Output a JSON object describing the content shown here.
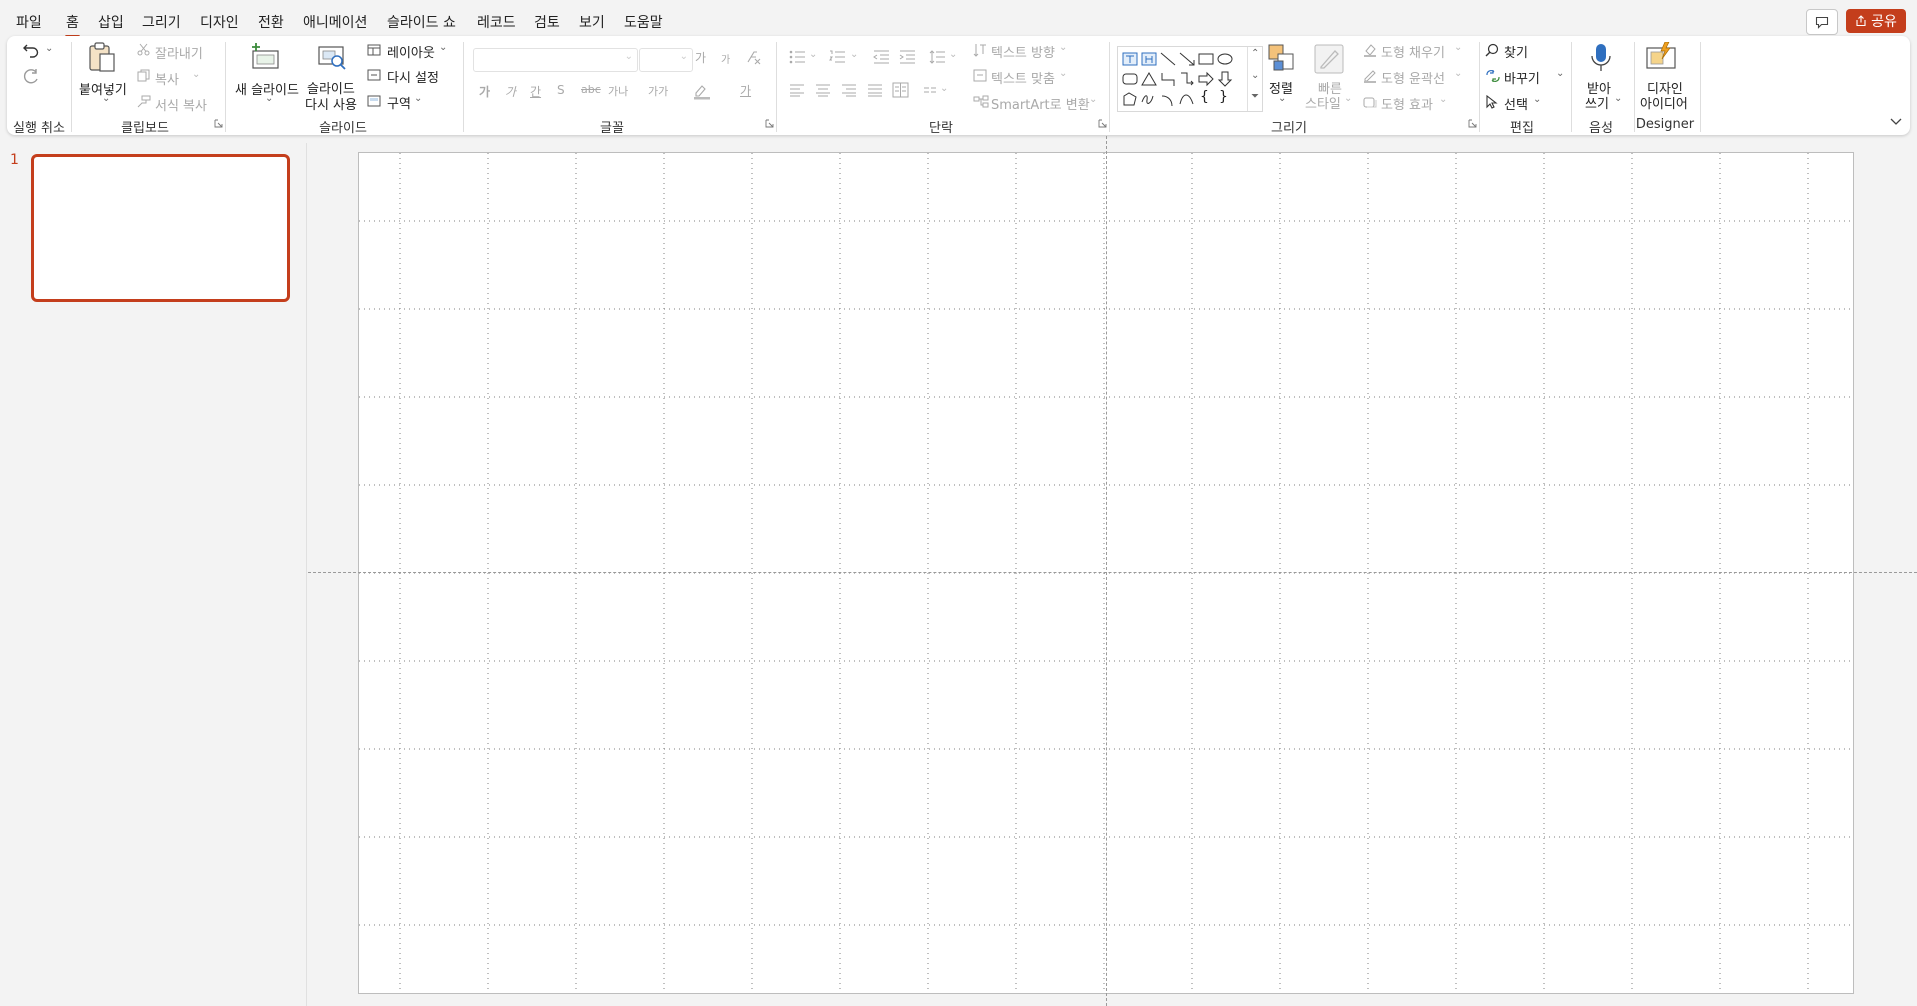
{
  "menu": {
    "tabs": [
      "파일",
      "홈",
      "삽입",
      "그리기",
      "디자인",
      "전환",
      "애니메이션",
      "슬라이드 쇼",
      "레코드",
      "검토",
      "보기",
      "도움말"
    ],
    "active_tab": "홈",
    "share_label": "공유"
  },
  "ribbon": {
    "undo": {
      "group_label": "실행 취소"
    },
    "clipboard": {
      "paste_label": "붙여넣기",
      "cut_label": "잘라내기",
      "copy_label": "복사",
      "format_painter_label": "서식 복사",
      "group_label": "클립보드"
    },
    "slides": {
      "new_slide_label": "새 슬라이드",
      "reuse_line1": "슬라이드",
      "reuse_line2": "다시 사용",
      "layout_label": "레이아웃",
      "reset_label": "다시 설정",
      "section_label": "구역",
      "group_label": "슬라이드"
    },
    "font": {
      "bold_glyph": "가",
      "italic_glyph": "가",
      "underline_glyph": "간",
      "strike_glyph": "S",
      "spacing_glyph": "가나",
      "case_glyph": "가가",
      "grow_glyph": "가",
      "shrink_glyph": "가",
      "font_color_glyph": "가",
      "group_label": "글꼴"
    },
    "paragraph": {
      "text_direction_label": "텍스트 방향",
      "align_text_label": "텍스트 맞춤",
      "smartart_label": "SmartArt로 변환",
      "group_label": "단락"
    },
    "drawing": {
      "arrange_label": "정렬",
      "quick_styles_line1": "빠른",
      "quick_styles_line2": "스타일",
      "shape_fill_label": "도형 채우기",
      "shape_outline_label": "도형 윤곽선",
      "shape_effects_label": "도형 효과",
      "group_label": "그리기"
    },
    "editing": {
      "find_label": "찾기",
      "replace_label": "바꾸기",
      "select_label": "선택",
      "group_label": "편집"
    },
    "voice": {
      "dictate_line1": "받아",
      "dictate_line2": "쓰기",
      "group_label": "음성"
    },
    "designer": {
      "ideas_line1": "디자인",
      "ideas_line2": "아이디어",
      "group_label": "Designer"
    }
  },
  "slides_pane": {
    "slides": [
      {
        "number": "1"
      }
    ]
  },
  "colors": {
    "accent": "#c43e1c",
    "ribbon_bg": "#ffffff",
    "app_bg": "#f3f3f3"
  }
}
